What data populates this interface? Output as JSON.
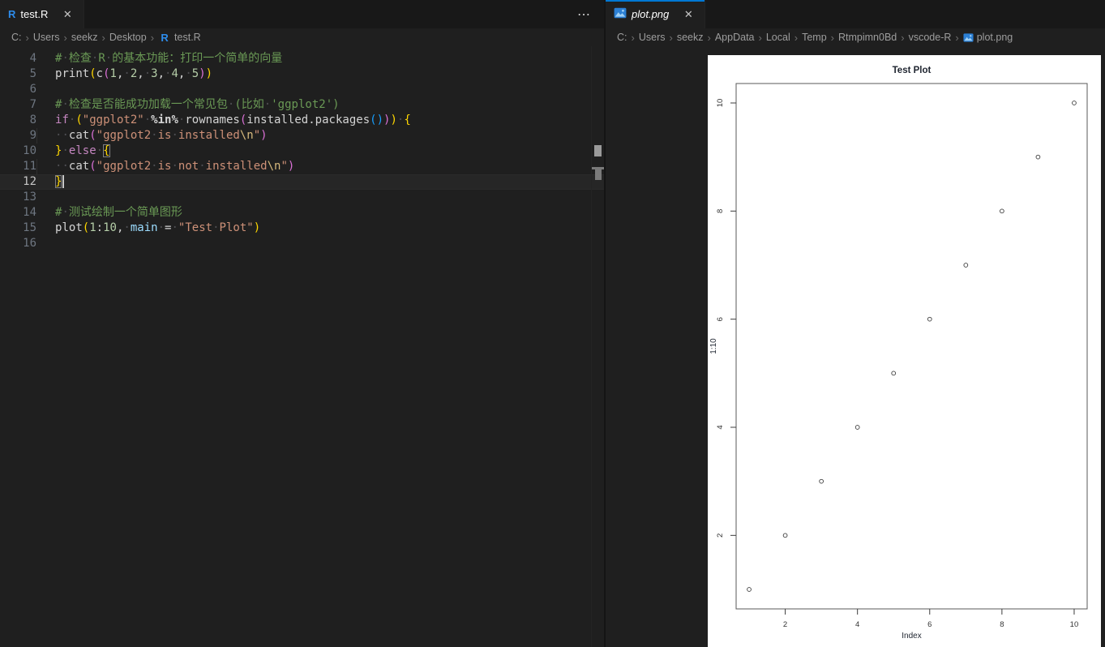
{
  "icons": {
    "r_logo": "R",
    "close": "✕",
    "ellipsis": "⋯",
    "chevron": "›",
    "space_dot": "·"
  },
  "left_group": {
    "tab": {
      "label": "test.R",
      "icon": "r"
    },
    "actions_ellipsis": "⋯",
    "breadcrumb": [
      {
        "label": "C:"
      },
      {
        "label": "Users"
      },
      {
        "label": "seekz"
      },
      {
        "label": "Desktop"
      },
      {
        "label": "test.R",
        "icon": "r"
      }
    ],
    "code": {
      "lines": [
        {
          "num": 4,
          "tokens": [
            [
              "c",
              "# 检查 R 的基本功能：打印一个简单的向量"
            ]
          ]
        },
        {
          "num": 5,
          "tokens": [
            [
              "p",
              "print"
            ],
            [
              "b1",
              "("
            ],
            [
              "p",
              "c"
            ],
            [
              "b2",
              "("
            ],
            [
              "n",
              "1"
            ],
            [
              "p",
              ", "
            ],
            [
              "n",
              "2"
            ],
            [
              "p",
              ", "
            ],
            [
              "n",
              "3"
            ],
            [
              "p",
              ", "
            ],
            [
              "n",
              "4"
            ],
            [
              "p",
              ", "
            ],
            [
              "n",
              "5"
            ],
            [
              "b2",
              ")"
            ],
            [
              "b1",
              ")"
            ]
          ]
        },
        {
          "num": 6,
          "tokens": []
        },
        {
          "num": 7,
          "tokens": [
            [
              "c",
              "# 检查是否能成功加载一个常见包 (比如 'ggplot2')"
            ]
          ]
        },
        {
          "num": 8,
          "tokens": [
            [
              "k",
              "if"
            ],
            [
              "p",
              " "
            ],
            [
              "b1",
              "("
            ],
            [
              "s",
              "\"ggplot2\""
            ],
            [
              "p",
              " "
            ],
            [
              "o",
              "%in%"
            ],
            [
              "p",
              " "
            ],
            [
              "p",
              "rownames"
            ],
            [
              "b2",
              "("
            ],
            [
              "p",
              "installed.packages"
            ],
            [
              "b3",
              "("
            ],
            [
              "b3",
              ")"
            ],
            [
              "b2",
              ")"
            ],
            [
              "b1",
              ")"
            ],
            [
              "p",
              " "
            ],
            [
              "b1",
              "{"
            ]
          ]
        },
        {
          "num": 9,
          "tokens": [
            [
              "p",
              "  "
            ],
            [
              "p",
              "cat"
            ],
            [
              "b2",
              "("
            ],
            [
              "s",
              "\"ggplot2 is installed"
            ],
            [
              "e",
              "\\n"
            ],
            [
              "s",
              "\""
            ],
            [
              "b2",
              ")"
            ]
          ]
        },
        {
          "num": 10,
          "tokens": [
            [
              "b1",
              "}"
            ],
            [
              "p",
              " "
            ],
            [
              "k",
              "else"
            ],
            [
              "p",
              " "
            ],
            [
              "b1 bm",
              "{"
            ]
          ]
        },
        {
          "num": 11,
          "tokens": [
            [
              "p",
              "  "
            ],
            [
              "p",
              "cat"
            ],
            [
              "b2",
              "("
            ],
            [
              "s",
              "\"ggplot2 is not installed"
            ],
            [
              "e",
              "\\n"
            ],
            [
              "s",
              "\""
            ],
            [
              "b2",
              ")"
            ]
          ]
        },
        {
          "num": 12,
          "tokens": [
            [
              "b1 bm",
              "}"
            ]
          ],
          "current": true,
          "cursor": true
        },
        {
          "num": 13,
          "tokens": []
        },
        {
          "num": 14,
          "tokens": [
            [
              "c",
              "# 测试绘制一个简单图形"
            ]
          ]
        },
        {
          "num": 15,
          "tokens": [
            [
              "p",
              "plot"
            ],
            [
              "b1",
              "("
            ],
            [
              "n",
              "1"
            ],
            [
              "p",
              ":"
            ],
            [
              "n",
              "10"
            ],
            [
              "p",
              ", "
            ],
            [
              "v",
              "main"
            ],
            [
              "p",
              " "
            ],
            [
              "p",
              "="
            ],
            [
              "p",
              " "
            ],
            [
              "s",
              "\"Test Plot\""
            ],
            [
              "b1",
              ")"
            ]
          ]
        },
        {
          "num": 16,
          "tokens": []
        }
      ]
    }
  },
  "right_group": {
    "tab": {
      "label": "plot.png",
      "icon": "image"
    },
    "breadcrumb": [
      {
        "label": "C:"
      },
      {
        "label": "Users"
      },
      {
        "label": "seekz"
      },
      {
        "label": "AppData"
      },
      {
        "label": "Local"
      },
      {
        "label": "Temp"
      },
      {
        "label": "Rtmpimn0Bd"
      },
      {
        "label": "vscode-R"
      },
      {
        "label": "plot.png",
        "icon": "image"
      }
    ]
  },
  "chart_data": {
    "type": "scatter",
    "title": "Test Plot",
    "xlabel": "Index",
    "ylabel": "1:10",
    "x": [
      1,
      2,
      3,
      4,
      5,
      6,
      7,
      8,
      9,
      10
    ],
    "y": [
      1,
      2,
      3,
      4,
      5,
      6,
      7,
      8,
      9,
      10
    ],
    "xticks": [
      2,
      4,
      6,
      8,
      10
    ],
    "yticks": [
      2,
      4,
      6,
      8,
      10
    ],
    "xlim": [
      0.64,
      10.36
    ],
    "ylim": [
      0.64,
      10.36
    ],
    "grid": false,
    "point_style": "open-circle",
    "colors": {
      "box": "#5a5a5a",
      "tick": "#3c3c3c",
      "label": "#333333",
      "title": "#1f2530",
      "point": "#3c3c3c"
    }
  }
}
